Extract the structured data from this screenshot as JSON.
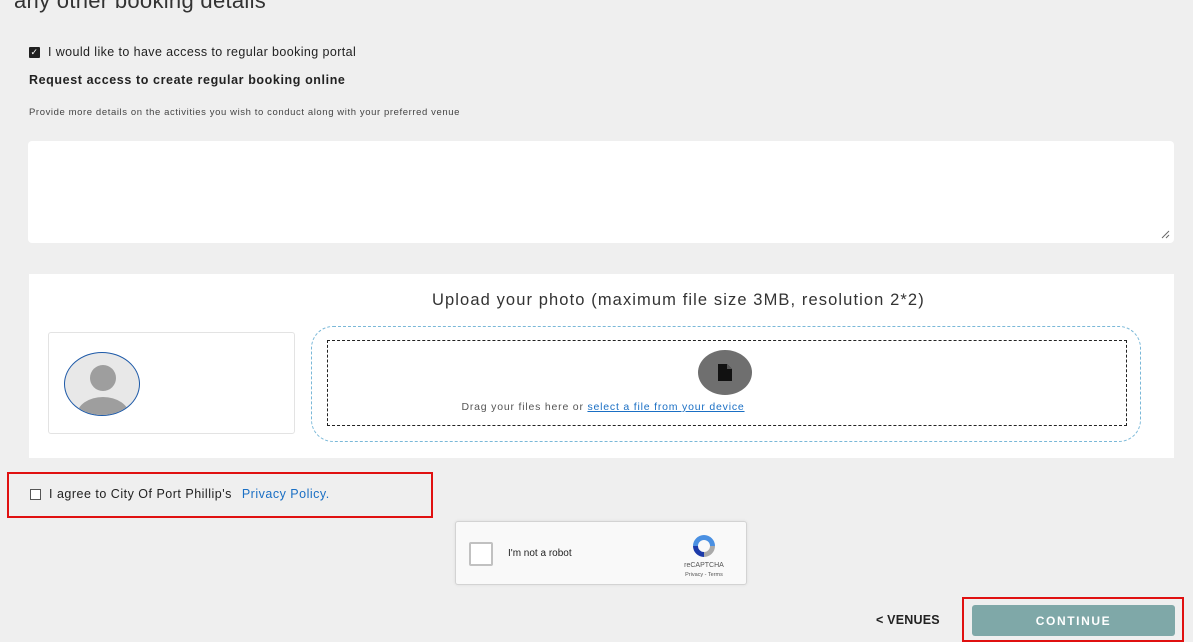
{
  "top_text": "any other booking details",
  "portal_access": {
    "checked": true,
    "label": "I would like to have access to regular booking portal"
  },
  "request_section": {
    "heading": "Request access to create regular booking online",
    "description": "Provide more details on the activities you wish to conduct along with your preferred venue",
    "textarea_value": ""
  },
  "upload": {
    "title": "Upload your photo (maximum file size 3MB, resolution 2*2)",
    "drag_text": "Drag your files here or ",
    "select_link": "select a file from your device"
  },
  "privacy": {
    "checked": false,
    "label": "I agree to City Of Port Phillip's",
    "link": "Privacy Policy."
  },
  "recaptcha": {
    "label": "I'm not a robot",
    "brand": "reCAPTCHA",
    "terms": "Privacy - Terms"
  },
  "nav": {
    "back_label": "< VENUES",
    "continue_label": "CONTINUE"
  },
  "colors": {
    "page_bg": "#efefef",
    "highlight_red": "#e01010",
    "continue_bg": "#7fa8a8",
    "link_blue": "#1a6fc4"
  }
}
